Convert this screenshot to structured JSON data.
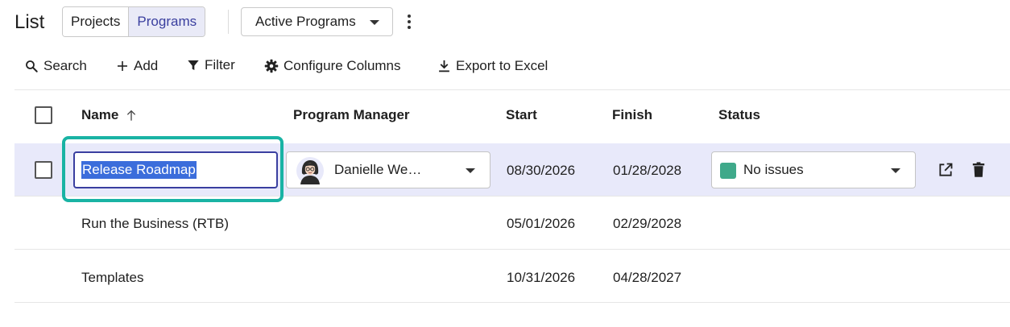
{
  "header": {
    "title": "List",
    "tabs": [
      {
        "label": "Projects",
        "active": false
      },
      {
        "label": "Programs",
        "active": true
      }
    ],
    "view_select": {
      "value": "Active Programs"
    },
    "more_icon": "vertical-dots-icon"
  },
  "toolbar": {
    "search_label": "Search",
    "add_label": "Add",
    "filter_label": "Filter",
    "configure_label": "Configure Columns",
    "export_label": "Export to Excel"
  },
  "table": {
    "columns": {
      "name": "Name",
      "manager": "Program Manager",
      "start": "Start",
      "finish": "Finish",
      "status": "Status"
    },
    "sort": {
      "column": "Name",
      "direction": "ascending"
    },
    "rows": [
      {
        "name": "Release Roadmap",
        "manager": "Danielle We…",
        "start": "08/30/2026",
        "finish": "01/28/2028",
        "status": "No issues",
        "selected": true,
        "editing": true
      },
      {
        "name": "Run the Business (RTB)",
        "manager": "",
        "start": "05/01/2026",
        "finish": "02/29/2028",
        "status": ""
      },
      {
        "name": "Templates",
        "manager": "",
        "start": "10/31/2026",
        "finish": "04/28/2027",
        "status": ""
      }
    ]
  },
  "colors": {
    "accent": "#3a3fa0",
    "selected_row": "#e8e9fa",
    "focus_ring": "#19b3a4",
    "status_ok": "#3fa98a",
    "text_selection": "#3b6ddb"
  }
}
